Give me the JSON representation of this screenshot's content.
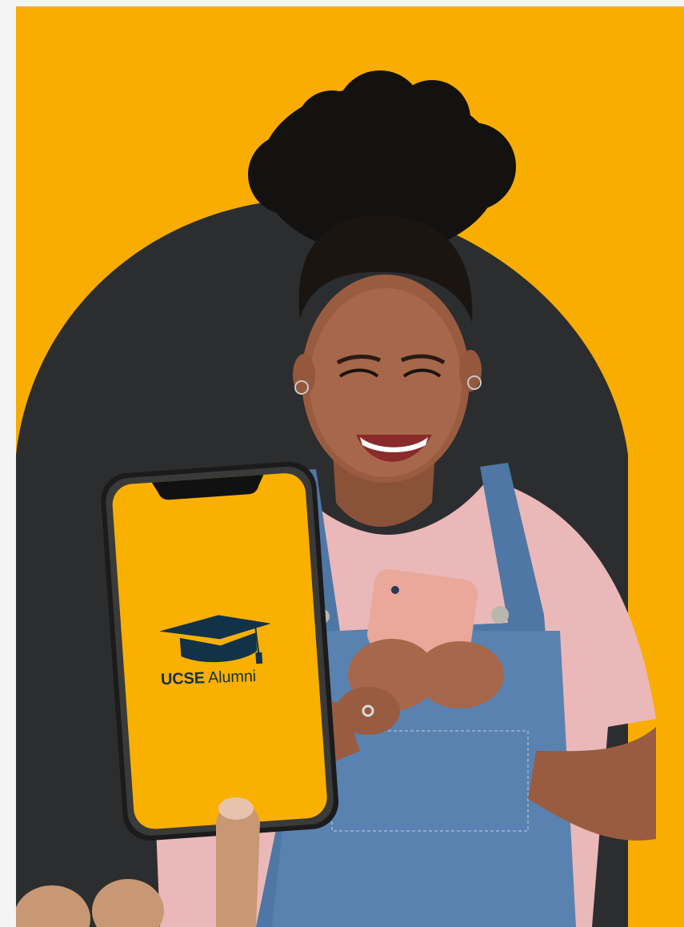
{
  "hero": {
    "background_color": "#f8ad00",
    "arch_color": "#2c2d2e",
    "phone_screen_color": "#f9b000",
    "brand_text_color": "#12324a"
  },
  "app_splash": {
    "logo_icon": "graduation-cap-icon",
    "brand_name_bold": "UCSE",
    "brand_name_light": "Alumni"
  }
}
